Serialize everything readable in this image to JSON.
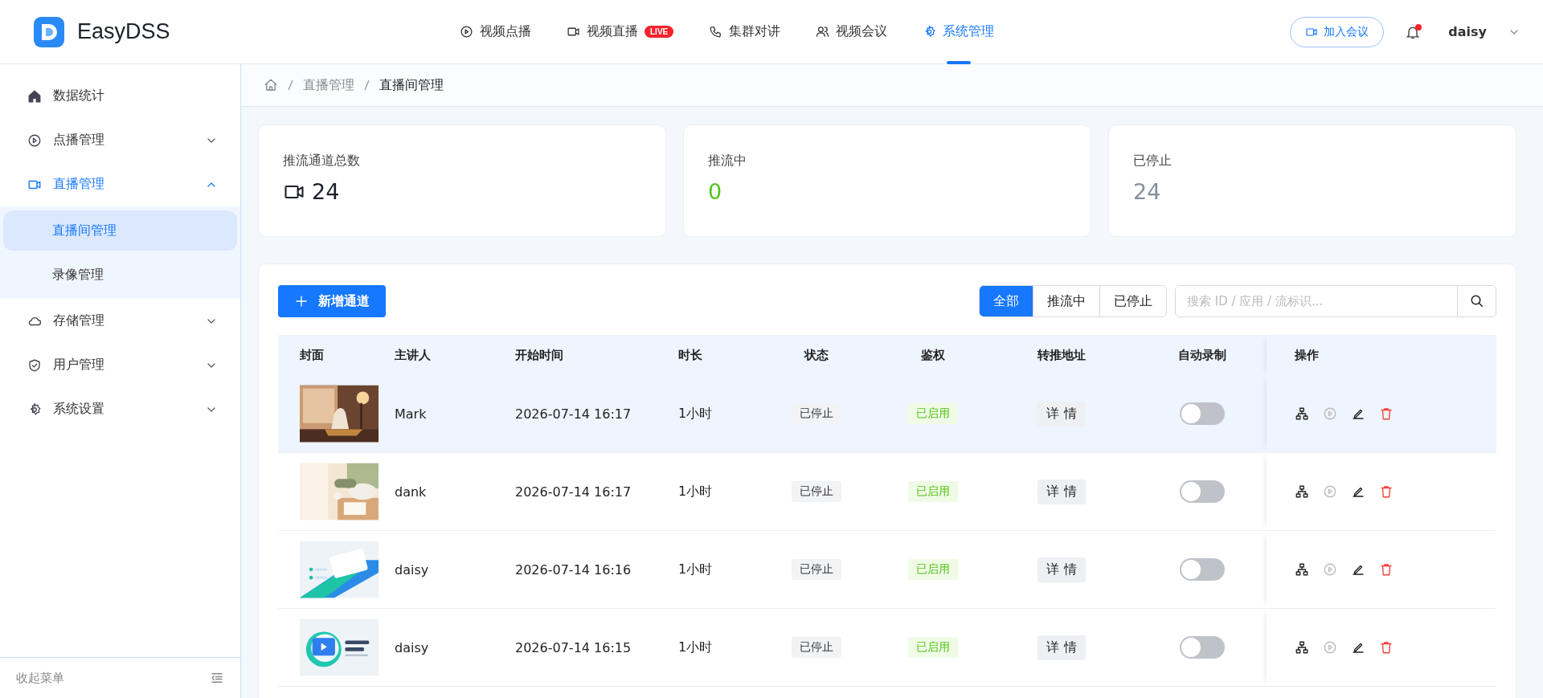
{
  "header": {
    "logo": "EasyDSS",
    "nav": [
      {
        "label": "视频点播",
        "kind": "vod",
        "selected": false
      },
      {
        "label": "视频直播",
        "kind": "live",
        "badge": "LIVE",
        "selected": false
      },
      {
        "label": "集群对讲",
        "kind": "talk",
        "selected": false
      },
      {
        "label": "视频会议",
        "kind": "meeting",
        "selected": false
      },
      {
        "label": "系统管理",
        "kind": "system",
        "selected": true
      }
    ],
    "join_button": "加入会议",
    "unread": true,
    "user": "daisy"
  },
  "sidebar": {
    "items": [
      {
        "label": "数据统计",
        "kind": "home",
        "selected": false
      },
      {
        "label": "点播管理",
        "kind": "vod",
        "selected": false,
        "expanded": false
      },
      {
        "label": "直播管理",
        "kind": "live",
        "selected": true,
        "expanded": true,
        "children": [
          {
            "label": "直播间管理",
            "selected": true
          },
          {
            "label": "录像管理",
            "selected": false
          }
        ]
      },
      {
        "label": "存储管理",
        "kind": "storage",
        "selected": false,
        "expanded": false
      },
      {
        "label": "用户管理",
        "kind": "user",
        "selected": false,
        "expanded": false
      },
      {
        "label": "系统设置",
        "kind": "settings",
        "selected": false,
        "expanded": false
      }
    ],
    "collapse_label": "收起菜单"
  },
  "breadcrumb": [
    "直播管理",
    "直播间管理"
  ],
  "stats": [
    {
      "label": "推流通道总数",
      "value": "24",
      "kind": "total"
    },
    {
      "label": "推流中",
      "value": "0",
      "kind": "live"
    },
    {
      "label": "已停止",
      "value": "24",
      "kind": "stopped"
    }
  ],
  "toolbar": {
    "add_button": "新增通道",
    "filters": [
      {
        "label": "全部",
        "selected": true
      },
      {
        "label": "推流中",
        "selected": false
      },
      {
        "label": "已停止",
        "selected": false
      }
    ],
    "search": {
      "placeholder": "搜索 ID / 应用 / 流标识..."
    }
  },
  "table": {
    "columns": [
      "封面",
      "主讲人",
      "开始时间",
      "时长",
      "状态",
      "鉴权",
      "转推地址",
      "自动录制",
      "操作"
    ],
    "rows": [
      {
        "presenter": "Mark",
        "start": "2026-07-14 16:17",
        "duration": "1小时",
        "status": "已停止",
        "auth": "已启用",
        "relay": "详 情",
        "auto_record": false,
        "selected": true
      },
      {
        "presenter": "dank",
        "start": "2026-07-14 16:17",
        "duration": "1小时",
        "status": "已停止",
        "auth": "已启用",
        "relay": "详 情",
        "auto_record": false,
        "selected": false
      },
      {
        "presenter": "daisy",
        "start": "2026-07-14 16:16",
        "duration": "1小时",
        "status": "已停止",
        "auth": "已启用",
        "relay": "详 情",
        "auto_record": false,
        "selected": false
      },
      {
        "presenter": "daisy",
        "start": "2026-07-14 16:15",
        "duration": "1小时",
        "status": "已停止",
        "auth": "已启用",
        "relay": "详 情",
        "auto_record": false,
        "selected": false
      }
    ]
  }
}
